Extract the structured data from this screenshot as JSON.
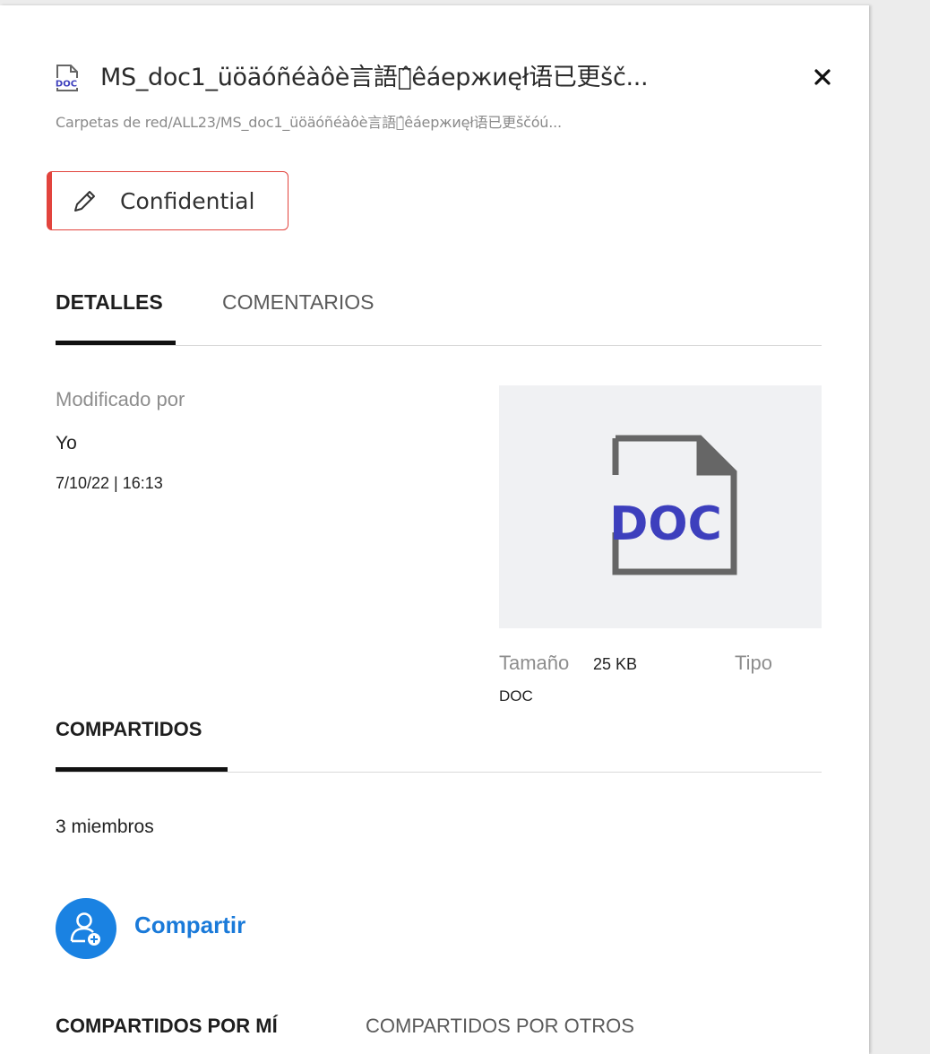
{
  "header": {
    "title": "MS_doc1_üöäóñéàôè言語が̂êáержиęł语已更šč...",
    "path": "Carpetas de red/ALL23/MS_doc1_üöäóñéàôè言語が̂êáержиęł语已更ščóú...",
    "file_icon_label": "DOC",
    "close_icon": "close-icon"
  },
  "classification": {
    "label": "Confidential",
    "icon": "pencil-icon",
    "accent_color": "#e2443d"
  },
  "tabs": [
    {
      "label": "DETALLES",
      "active": true
    },
    {
      "label": "COMENTARIOS",
      "active": false
    }
  ],
  "details": {
    "modified_by_label": "Modificado por",
    "modified_by_value": "Yo",
    "modified_date": "7/10/22 | 16:13",
    "size_label": "Tamaño",
    "size_value": "25 KB",
    "type_label": "Tipo",
    "type_value": "DOC",
    "preview_label": "DOC"
  },
  "shared": {
    "section_title": "COMPARTIDOS",
    "members": "3 miembros",
    "share_button": "Compartir",
    "share_icon": "add-user-icon",
    "accent_color": "#1a82e2",
    "subtabs": [
      {
        "label": "COMPARTIDOS POR MÍ",
        "active": true
      },
      {
        "label": "COMPARTIDOS POR OTROS",
        "active": false
      }
    ]
  }
}
